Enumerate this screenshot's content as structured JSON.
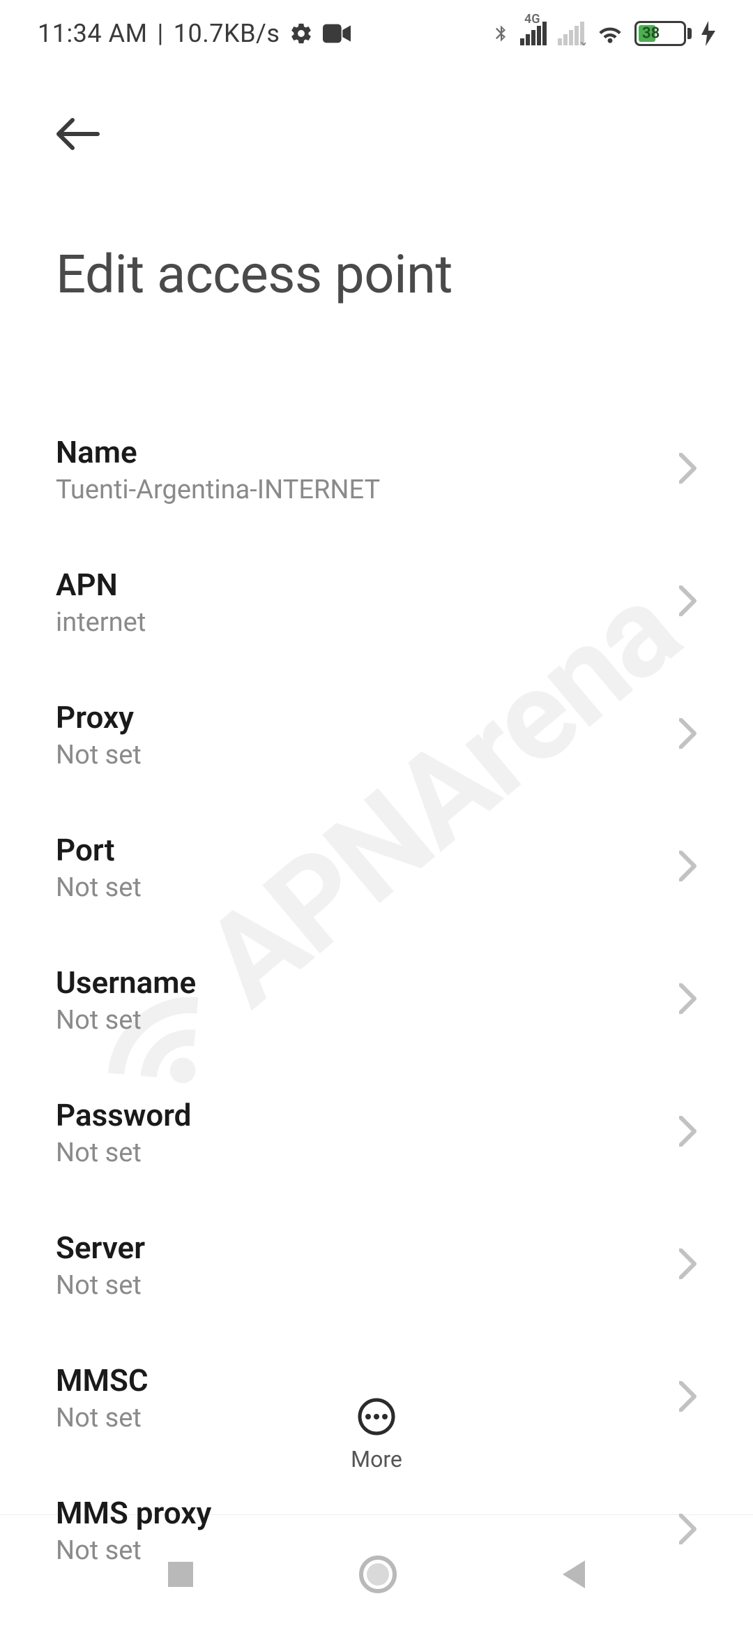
{
  "status_bar": {
    "time": "11:34 AM",
    "separator": "|",
    "data_rate": "10.7KB/s",
    "network_badge": "4G",
    "battery_percent": "38"
  },
  "header": {
    "title": "Edit access point"
  },
  "fields": [
    {
      "title": "Name",
      "value": "Tuenti-Argentina-INTERNET"
    },
    {
      "title": "APN",
      "value": "internet"
    },
    {
      "title": "Proxy",
      "value": "Not set"
    },
    {
      "title": "Port",
      "value": "Not set"
    },
    {
      "title": "Username",
      "value": "Not set"
    },
    {
      "title": "Password",
      "value": "Not set"
    },
    {
      "title": "Server",
      "value": "Not set"
    },
    {
      "title": "MMSC",
      "value": "Not set"
    },
    {
      "title": "MMS proxy",
      "value": "Not set"
    }
  ],
  "bottom": {
    "more_label": "More"
  },
  "watermark": {
    "text": "APNArena"
  }
}
